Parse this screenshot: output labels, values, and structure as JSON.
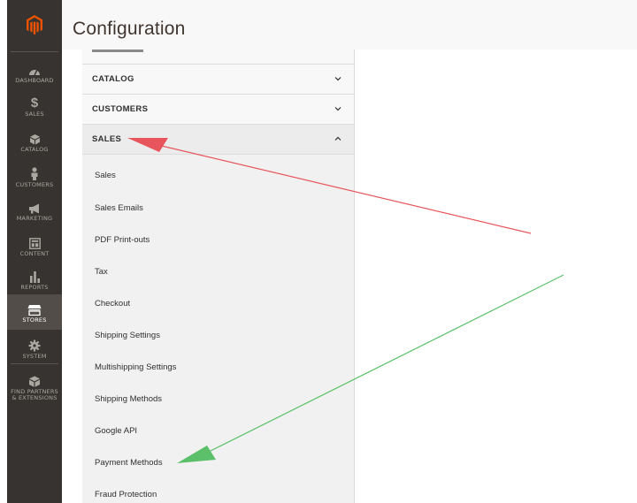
{
  "header": {
    "title": "Configuration"
  },
  "nav": {
    "items": [
      {
        "label": "DASHBOARD",
        "icon": "dashboard-gauge-icon"
      },
      {
        "label": "SALES",
        "icon": "dollar-icon"
      },
      {
        "label": "CATALOG",
        "icon": "box-icon"
      },
      {
        "label": "CUSTOMERS",
        "icon": "person-icon"
      },
      {
        "label": "MARKETING",
        "icon": "megaphone-icon"
      },
      {
        "label": "CONTENT",
        "icon": "layout-icon"
      },
      {
        "label": "REPORTS",
        "icon": "bar-chart-icon"
      },
      {
        "label": "STORES",
        "icon": "storefront-icon"
      },
      {
        "label": "SYSTEM",
        "icon": "gear-icon"
      },
      {
        "label_line1": "FIND PARTNERS",
        "label_line2": "& EXTENSIONS",
        "icon": "cube-icon"
      }
    ]
  },
  "config": {
    "sections": [
      {
        "label": "CATALOG",
        "state": "collapsed"
      },
      {
        "label": "CUSTOMERS",
        "state": "collapsed"
      },
      {
        "label": "SALES",
        "state": "expanded"
      }
    ],
    "sales_items": [
      "Sales",
      "Sales Emails",
      "PDF Print-outs",
      "Tax",
      "Checkout",
      "Shipping Settings",
      "Multishipping Settings",
      "Shipping Methods",
      "Google API",
      "Payment Methods",
      "Fraud Protection"
    ]
  },
  "annotations": {
    "red_arrow_color": "#e8555c",
    "green_arrow_color": "#5cc06a"
  },
  "colors": {
    "nav_bg": "#373330",
    "nav_active": "#524d49",
    "logo_orange": "#eb5202"
  }
}
